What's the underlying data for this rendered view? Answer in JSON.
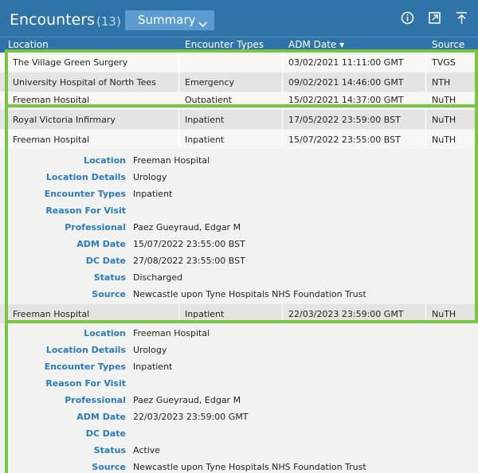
{
  "header": {
    "title": "Encounters",
    "count": "(13)",
    "view_select": "Summary",
    "icons": [
      "info-icon",
      "popout-icon",
      "collapse-top-icon"
    ],
    "accent_color": "#2f74a8"
  },
  "columns": [
    "Location",
    "Encounter Types",
    "ADM Date ▾",
    "Source"
  ],
  "rows": [
    {
      "location": "The Village Green Surgery",
      "type": "",
      "adm": "03/02/2021 11:11:00 GMT",
      "source": "TVGS"
    },
    {
      "location": "University Hospital of North Tees",
      "type": "Emergency",
      "adm": "09/02/2021 14:46:00 GMT",
      "source": "NTH"
    },
    {
      "location": "Freeman Hospital",
      "type": "Outpatient",
      "adm": "15/02/2021 14:37:00 GMT",
      "source": "NuTH"
    },
    {
      "location": "Royal Victoria Infirmary",
      "type": "Inpatient",
      "adm": "17/05/2022 23:59:00 BST",
      "source": "NuTH"
    },
    {
      "location": "Freeman Hospital",
      "type": "Inpatient",
      "adm": "15/07/2022 23:55:00 BST",
      "source": "NuTH"
    },
    {
      "location": "Freeman Hospital",
      "type": "Inpatient",
      "adm": "22/03/2023 23:59:00 GMT",
      "source": "NuTH"
    }
  ],
  "details": [
    {
      "labels": {
        "location": "Location",
        "location_details": "Location Details",
        "encounter_types": "Encounter Types",
        "reason": "Reason For Visit",
        "professional": "Professional",
        "adm": "ADM Date",
        "dc": "DC Date",
        "status": "Status",
        "source": "Source"
      },
      "location": "Freeman Hospital",
      "location_details": "Urology",
      "encounter_types": "Inpatient",
      "reason": "",
      "professional": "Paez Gueyraud, Edgar M",
      "adm": "15/07/2022 23:55:00 BST",
      "dc": "27/08/2022 23:55:00 BST",
      "status": "Discharged",
      "source": "Newcastle upon Tyne Hospitals NHS Foundation Trust"
    },
    {
      "labels": {
        "location": "Location",
        "location_details": "Location Details",
        "encounter_types": "Encounter Types",
        "reason": "Reason For Visit",
        "professional": "Professional",
        "adm": "ADM Date",
        "dc": "DC Date",
        "status": "Status",
        "source": "Source"
      },
      "location": "Freeman Hospital",
      "location_details": "Urology",
      "encounter_types": "Inpatient",
      "reason": "",
      "professional": "Paez Gueyraud, Edgar M",
      "adm": "22/03/2023 23:59:00 GMT",
      "dc": "",
      "status": "Active",
      "source": "Newcastle upon Tyne Hospitals NHS Foundation Trust"
    }
  ],
  "highlight_color": "#7bc443"
}
